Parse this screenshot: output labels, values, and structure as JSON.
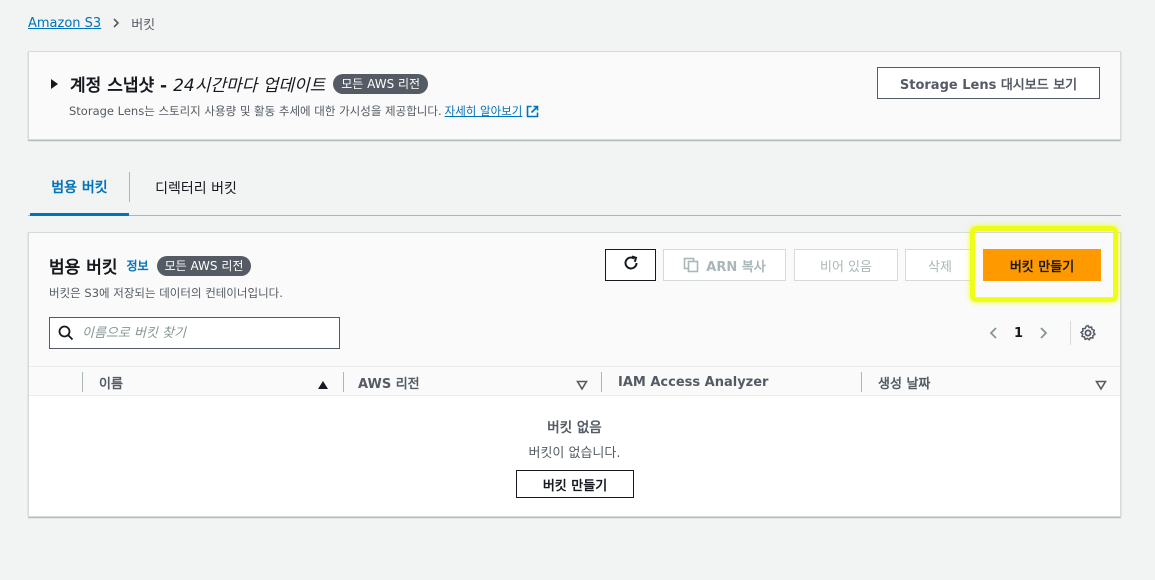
{
  "breadcrumb": {
    "root": "Amazon S3",
    "current": "버킷"
  },
  "snapshot": {
    "title_strong": "계정 스냅샷 -",
    "title_italic": "24시간마다 업데이트",
    "badge": "모든 AWS 리전",
    "description": "Storage Lens는 스토리지 사용량 및 활동 추세에 대한 가시성을 제공합니다.",
    "learn_more": "자세히 알아보기",
    "dashboard_button": "Storage Lens 대시보드 보기"
  },
  "tabs": [
    {
      "label": "범용 버킷",
      "active": true
    },
    {
      "label": "디렉터리 버킷",
      "active": false
    }
  ],
  "buckets": {
    "title": "범용 버킷",
    "info_link": "정보",
    "badge": "모든 AWS 리전",
    "description": "버킷은 S3에 저장되는 데이터의 컨테이너입니다.",
    "buttons": {
      "copy_arn": "ARN 복사",
      "empty": "비어 있음",
      "delete": "삭제",
      "create": "버킷 만들기"
    },
    "search_placeholder": "이름으로 버킷 찾기",
    "page": "1",
    "columns": [
      "이름",
      "AWS 리전",
      "IAM Access Analyzer",
      "생성 날짜"
    ],
    "empty_title": "버킷 없음",
    "empty_desc": "버킷이 없습니다.",
    "empty_create": "버킷 만들기"
  },
  "colors": {
    "primary_button": "#ff9900",
    "link": "#0073bb",
    "highlight": "#eeff00"
  }
}
